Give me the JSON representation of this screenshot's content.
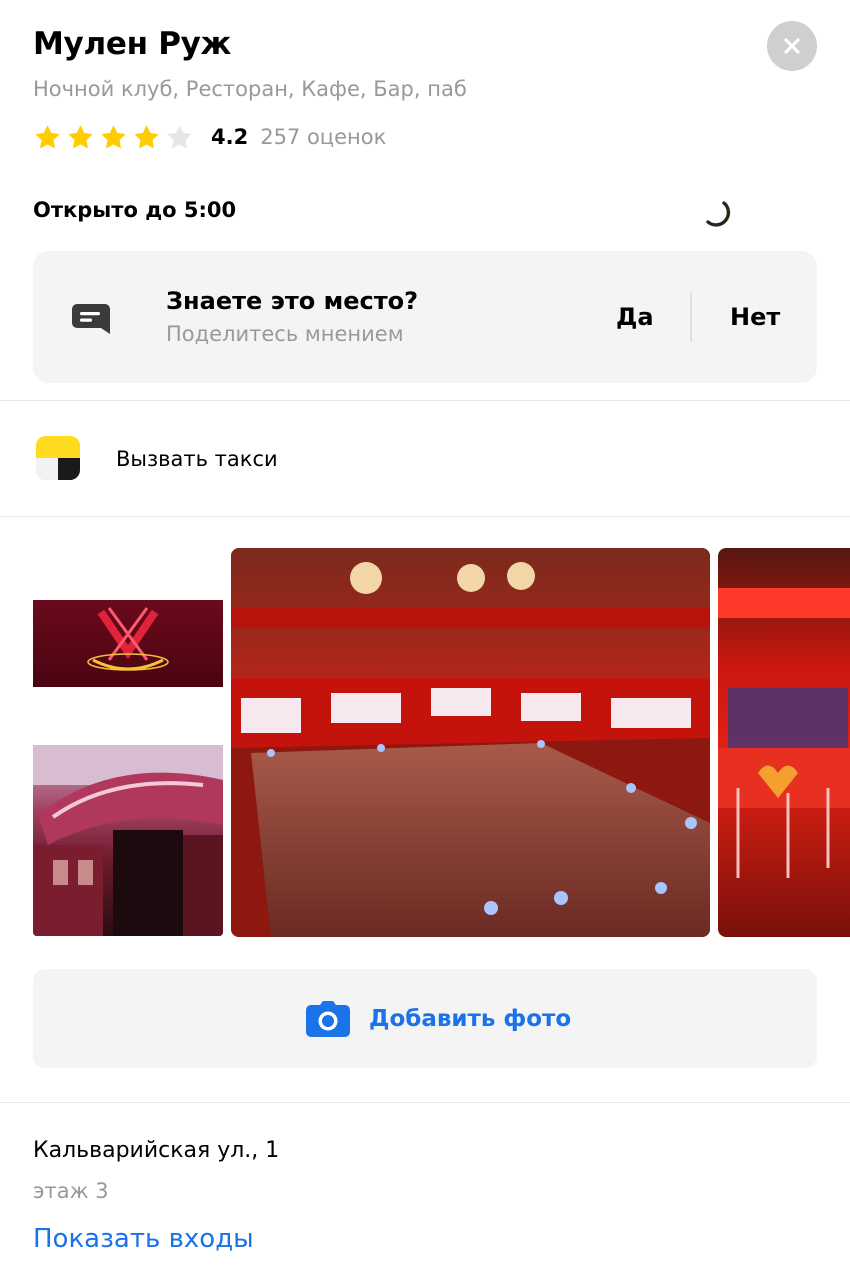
{
  "place": {
    "name": "Мулен Руж",
    "categories": "Ночной клуб, Ресторан, Кафе, Бар, паб",
    "rating_value": "4.2",
    "rating_stars": 4.2,
    "rating_count": "257 оценок",
    "hours": "Открыто до 5:00"
  },
  "feedback": {
    "title": "Знаете это место?",
    "subtitle": "Поделитесь мнением",
    "yes_label": "Да",
    "no_label": "Нет"
  },
  "taxi": {
    "label": "Вызвать такси"
  },
  "photos": {
    "add_label": "Добавить фото"
  },
  "address": {
    "street": "Кальварийская ул., 1",
    "floor": "этаж 3",
    "entrances_link": "Показать входы"
  },
  "colors": {
    "star_active": "#ffcc00",
    "star_inactive": "#e6e6e6",
    "link": "#1a73e8",
    "card_bg": "#f4f4f4"
  },
  "icons": [
    "close-icon",
    "star-icon",
    "loading-spinner-icon",
    "chat-icon",
    "taxi-icon",
    "camera-icon"
  ]
}
